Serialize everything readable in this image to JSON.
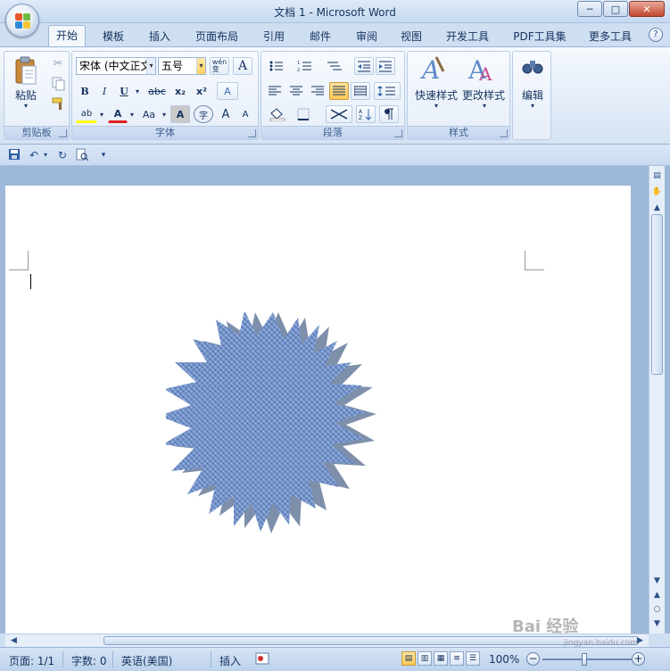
{
  "window": {
    "title": "文档 1 - Microsoft Word",
    "minimize": "─",
    "maximize": "□",
    "close": "✕"
  },
  "tabs": [
    {
      "label": "开始",
      "active": true
    },
    {
      "label": "模板"
    },
    {
      "label": "插入"
    },
    {
      "label": "页面布局"
    },
    {
      "label": "引用"
    },
    {
      "label": "邮件"
    },
    {
      "label": "审阅"
    },
    {
      "label": "视图"
    },
    {
      "label": "开发工具"
    },
    {
      "label": "PDF工具集"
    },
    {
      "label": "更多工具"
    }
  ],
  "help": "?",
  "ribbon": {
    "clipboard": {
      "label": "剪贴板",
      "paste": "粘贴"
    },
    "font": {
      "label": "字体",
      "font_name": "宋体 (中文正文",
      "font_size": "五号",
      "phonetic": "wén\n变",
      "char_border": "A",
      "bold": "B",
      "italic": "I",
      "underline": "U",
      "strike": "abc",
      "subscript": "x₂",
      "superscript": "x²",
      "clear": "A",
      "highlight": "ab",
      "font_color": "A",
      "change_case": "Aa",
      "char_shading": "A",
      "enclose": "字",
      "grow": "A",
      "shrink": "A"
    },
    "paragraph": {
      "label": "段落"
    },
    "styles": {
      "label": "样式",
      "quick_styles": "快速样式",
      "change_styles": "更改样式"
    },
    "editing": {
      "label": "编辑"
    }
  },
  "qat": {
    "customize": "▾"
  },
  "statusbar": {
    "page": "页面: 1/1",
    "words": "字数: 0",
    "language": "英语(美国)",
    "insert": "插入",
    "zoom": "100%"
  },
  "watermark": {
    "text": "Bai 经验",
    "url": "jingyan.baidu.com"
  },
  "colors": {
    "accent": "#15325f",
    "ribbon": "#e3ecf8",
    "shape_fill": "#6f8fc5",
    "shape_shadow": "#7d8ea8",
    "font_color": "#e02020",
    "highlight": "#ffff00"
  },
  "icons": {
    "paste": "clipboard-icon",
    "cut": "scissors-icon",
    "copy": "copy-icon",
    "format_painter": "brush-icon",
    "quick_styles": "styles-icon",
    "change_styles": "change-styles-icon",
    "editing": "binoculars-icon"
  }
}
